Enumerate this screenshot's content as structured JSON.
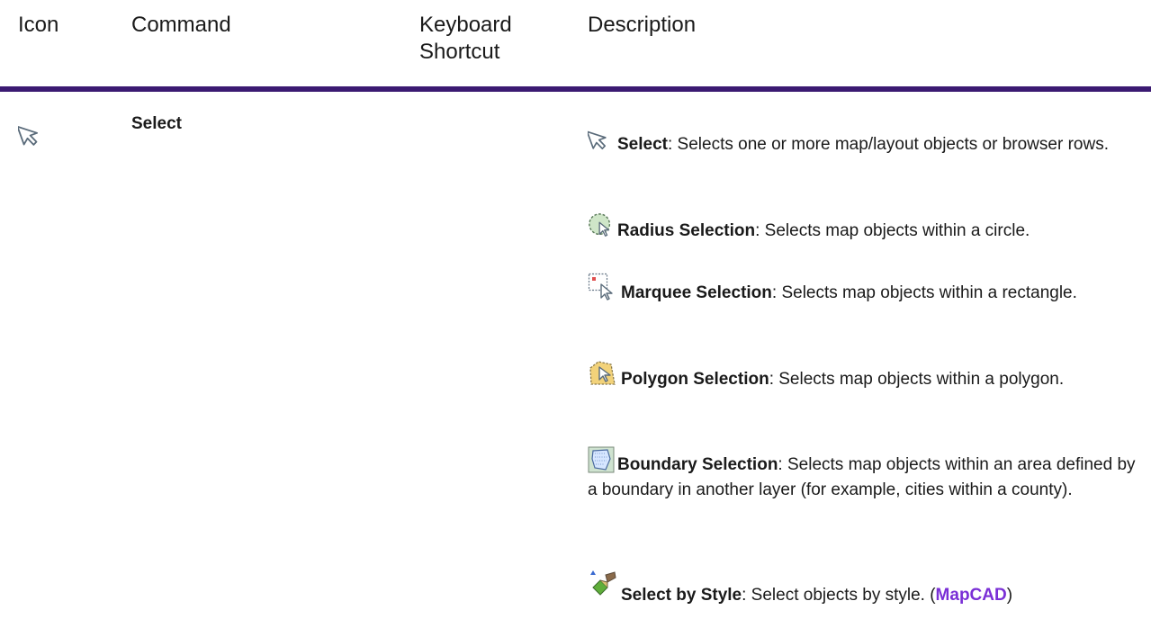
{
  "table": {
    "headers": {
      "icon": "Icon",
      "command": "Command",
      "shortcut_line1": "Keyboard",
      "shortcut_line2": "Shortcut",
      "description": "Description"
    },
    "row": {
      "command": "Select",
      "shortcut": "",
      "icon": "select-arrow-icon",
      "items": [
        {
          "icon": "select-arrow-icon",
          "name": "Select",
          "text": ": Selects one or more map/layout objects or browser rows."
        },
        {
          "icon": "radius-selection-icon",
          "name": "Radius Selection",
          "text": ": Selects map objects within a circle."
        },
        {
          "icon": "marquee-selection-icon",
          "name": "Marquee Selection",
          "text": ": Selects map objects within a rectangle."
        },
        {
          "icon": "polygon-selection-icon",
          "name": "Polygon Selection",
          "text": ": Selects map objects within a polygon."
        },
        {
          "icon": "boundary-selection-icon",
          "name": "Boundary Selection",
          "text": ": Selects map objects within an area defined by a boundary in another layer (for example, cities within a county)."
        },
        {
          "icon": "select-by-style-icon",
          "name": "Select by Style",
          "text": ": Select objects by style. (",
          "link": "MapCAD",
          "text_after": ")"
        }
      ]
    }
  },
  "colors": {
    "rule": "#3b1a72",
    "link": "#7a2fd6"
  }
}
